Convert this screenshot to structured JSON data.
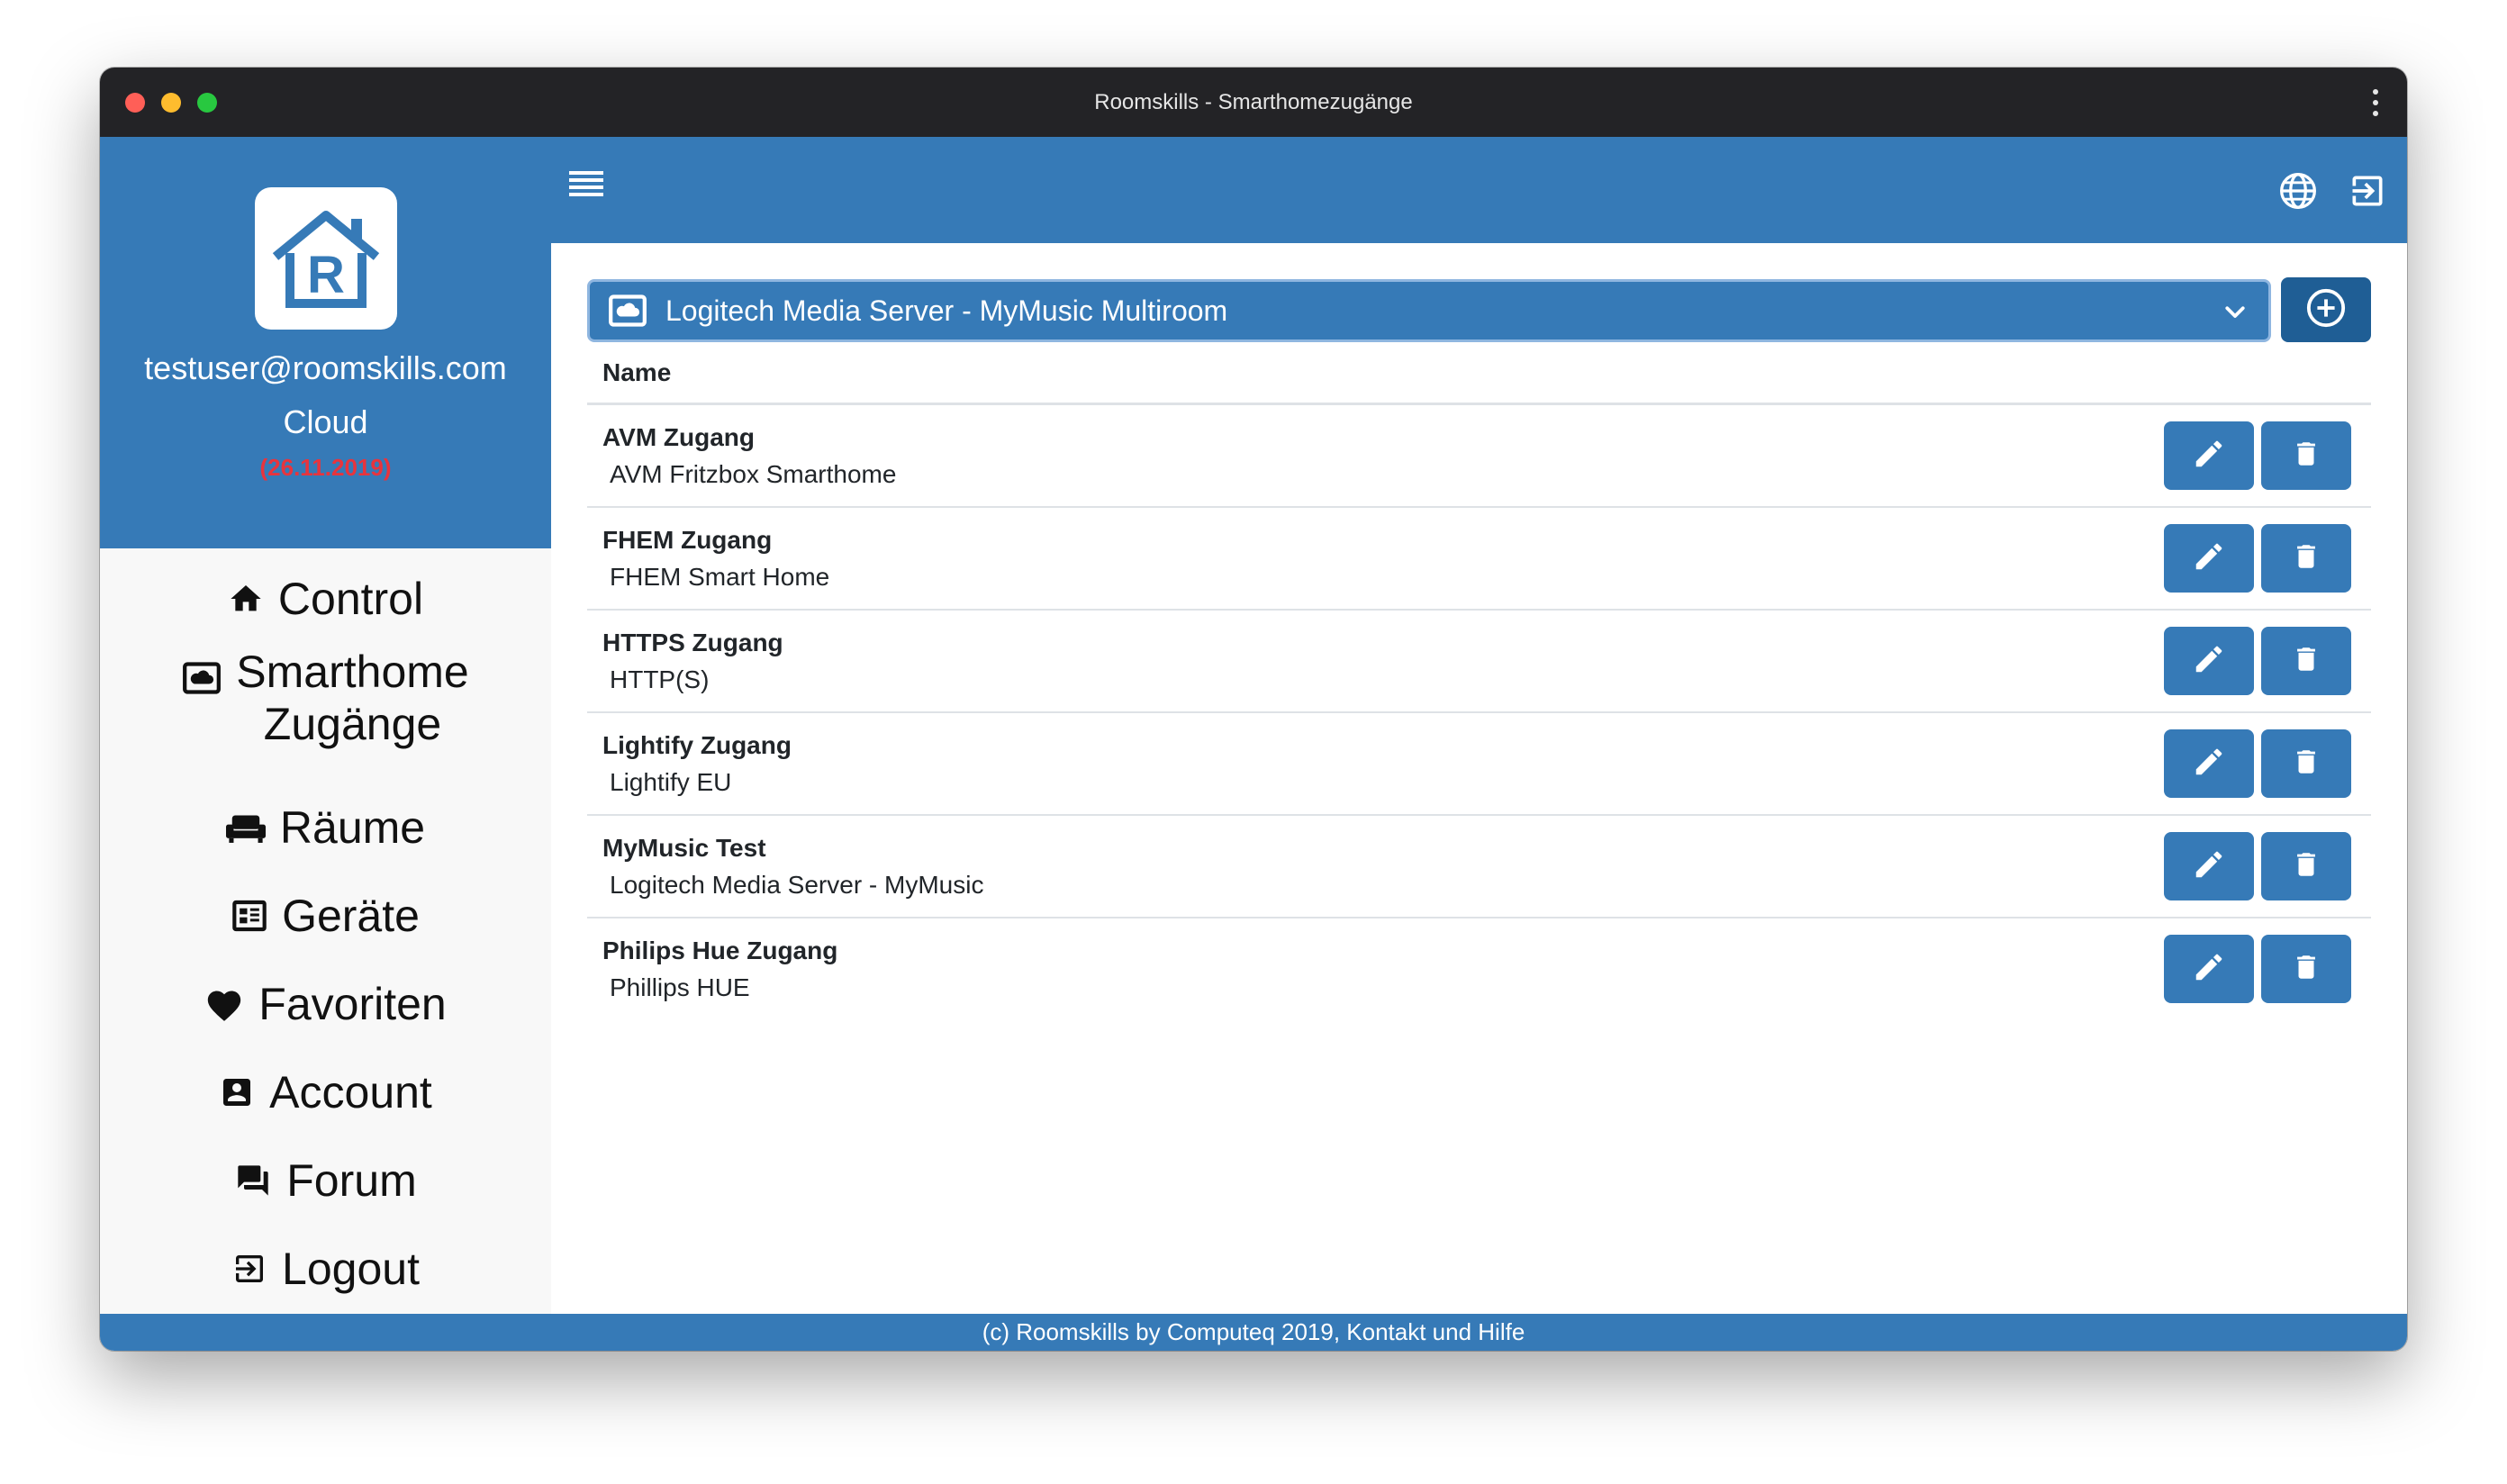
{
  "window": {
    "title": "Roomskills - Smarthomezugänge"
  },
  "sidebar": {
    "email": "testuser@roomskills.com",
    "plan": "Cloud",
    "date": "(26.11.2019)",
    "items": [
      {
        "label": "Control",
        "icon": "home-icon"
      },
      {
        "label": "Smarthome",
        "label2": "Zugänge",
        "icon": "cloud-box-icon"
      },
      {
        "label": "Räume",
        "icon": "sofa-icon"
      },
      {
        "label": "Geräte",
        "icon": "device-panel-icon"
      },
      {
        "label": "Favoriten",
        "icon": "heart-icon"
      },
      {
        "label": "Account",
        "icon": "account-box-icon"
      },
      {
        "label": "Forum",
        "icon": "forum-icon"
      },
      {
        "label": "Logout",
        "icon": "logout-icon"
      }
    ]
  },
  "topbar": {
    "icons": [
      "menu-icon",
      "globe-icon",
      "logout-icon"
    ]
  },
  "main": {
    "select_value": "Logitech Media Server - MyMusic Multiroom",
    "column_header": "Name",
    "rows": [
      {
        "name": "AVM Zugang",
        "type": "AVM Fritzbox Smarthome"
      },
      {
        "name": "FHEM Zugang",
        "type": "FHEM Smart Home"
      },
      {
        "name": "HTTPS Zugang",
        "type": "HTTP(S)"
      },
      {
        "name": "Lightify Zugang",
        "type": "Lightify EU"
      },
      {
        "name": "MyMusic Test",
        "type": "Logitech Media Server - MyMusic"
      },
      {
        "name": "Philips Hue Zugang",
        "type": "Phillips HUE"
      }
    ]
  },
  "footer": {
    "text": "(c) Roomskills by Computeq 2019, Kontakt und Hilfe"
  },
  "colors": {
    "primary": "#367ab7",
    "dark_primary": "#1f5e95",
    "titlebar": "#232326",
    "date_red": "#e8343d"
  }
}
